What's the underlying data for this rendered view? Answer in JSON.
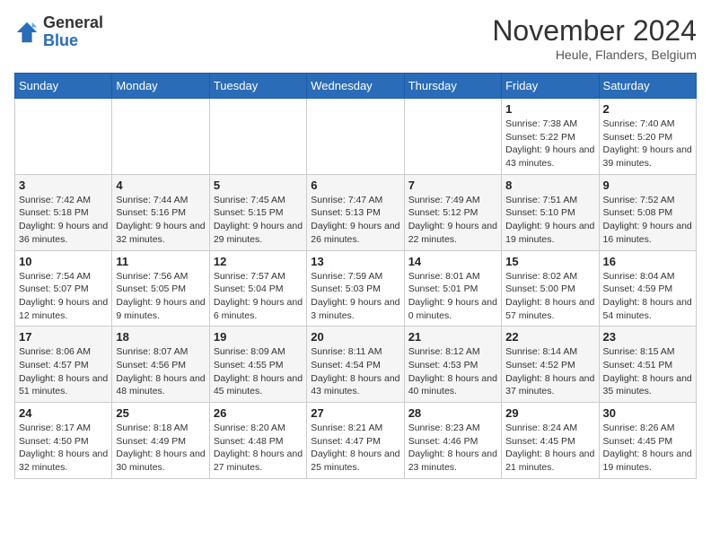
{
  "header": {
    "logo_general": "General",
    "logo_blue": "Blue",
    "month_title": "November 2024",
    "location": "Heule, Flanders, Belgium"
  },
  "weekdays": [
    "Sunday",
    "Monday",
    "Tuesday",
    "Wednesday",
    "Thursday",
    "Friday",
    "Saturday"
  ],
  "weeks": [
    [
      {
        "day": "",
        "sunrise": "",
        "sunset": "",
        "daylight": ""
      },
      {
        "day": "",
        "sunrise": "",
        "sunset": "",
        "daylight": ""
      },
      {
        "day": "",
        "sunrise": "",
        "sunset": "",
        "daylight": ""
      },
      {
        "day": "",
        "sunrise": "",
        "sunset": "",
        "daylight": ""
      },
      {
        "day": "",
        "sunrise": "",
        "sunset": "",
        "daylight": ""
      },
      {
        "day": "1",
        "sunrise": "Sunrise: 7:38 AM",
        "sunset": "Sunset: 5:22 PM",
        "daylight": "Daylight: 9 hours and 43 minutes."
      },
      {
        "day": "2",
        "sunrise": "Sunrise: 7:40 AM",
        "sunset": "Sunset: 5:20 PM",
        "daylight": "Daylight: 9 hours and 39 minutes."
      }
    ],
    [
      {
        "day": "3",
        "sunrise": "Sunrise: 7:42 AM",
        "sunset": "Sunset: 5:18 PM",
        "daylight": "Daylight: 9 hours and 36 minutes."
      },
      {
        "day": "4",
        "sunrise": "Sunrise: 7:44 AM",
        "sunset": "Sunset: 5:16 PM",
        "daylight": "Daylight: 9 hours and 32 minutes."
      },
      {
        "day": "5",
        "sunrise": "Sunrise: 7:45 AM",
        "sunset": "Sunset: 5:15 PM",
        "daylight": "Daylight: 9 hours and 29 minutes."
      },
      {
        "day": "6",
        "sunrise": "Sunrise: 7:47 AM",
        "sunset": "Sunset: 5:13 PM",
        "daylight": "Daylight: 9 hours and 26 minutes."
      },
      {
        "day": "7",
        "sunrise": "Sunrise: 7:49 AM",
        "sunset": "Sunset: 5:12 PM",
        "daylight": "Daylight: 9 hours and 22 minutes."
      },
      {
        "day": "8",
        "sunrise": "Sunrise: 7:51 AM",
        "sunset": "Sunset: 5:10 PM",
        "daylight": "Daylight: 9 hours and 19 minutes."
      },
      {
        "day": "9",
        "sunrise": "Sunrise: 7:52 AM",
        "sunset": "Sunset: 5:08 PM",
        "daylight": "Daylight: 9 hours and 16 minutes."
      }
    ],
    [
      {
        "day": "10",
        "sunrise": "Sunrise: 7:54 AM",
        "sunset": "Sunset: 5:07 PM",
        "daylight": "Daylight: 9 hours and 12 minutes."
      },
      {
        "day": "11",
        "sunrise": "Sunrise: 7:56 AM",
        "sunset": "Sunset: 5:05 PM",
        "daylight": "Daylight: 9 hours and 9 minutes."
      },
      {
        "day": "12",
        "sunrise": "Sunrise: 7:57 AM",
        "sunset": "Sunset: 5:04 PM",
        "daylight": "Daylight: 9 hours and 6 minutes."
      },
      {
        "day": "13",
        "sunrise": "Sunrise: 7:59 AM",
        "sunset": "Sunset: 5:03 PM",
        "daylight": "Daylight: 9 hours and 3 minutes."
      },
      {
        "day": "14",
        "sunrise": "Sunrise: 8:01 AM",
        "sunset": "Sunset: 5:01 PM",
        "daylight": "Daylight: 9 hours and 0 minutes."
      },
      {
        "day": "15",
        "sunrise": "Sunrise: 8:02 AM",
        "sunset": "Sunset: 5:00 PM",
        "daylight": "Daylight: 8 hours and 57 minutes."
      },
      {
        "day": "16",
        "sunrise": "Sunrise: 8:04 AM",
        "sunset": "Sunset: 4:59 PM",
        "daylight": "Daylight: 8 hours and 54 minutes."
      }
    ],
    [
      {
        "day": "17",
        "sunrise": "Sunrise: 8:06 AM",
        "sunset": "Sunset: 4:57 PM",
        "daylight": "Daylight: 8 hours and 51 minutes."
      },
      {
        "day": "18",
        "sunrise": "Sunrise: 8:07 AM",
        "sunset": "Sunset: 4:56 PM",
        "daylight": "Daylight: 8 hours and 48 minutes."
      },
      {
        "day": "19",
        "sunrise": "Sunrise: 8:09 AM",
        "sunset": "Sunset: 4:55 PM",
        "daylight": "Daylight: 8 hours and 45 minutes."
      },
      {
        "day": "20",
        "sunrise": "Sunrise: 8:11 AM",
        "sunset": "Sunset: 4:54 PM",
        "daylight": "Daylight: 8 hours and 43 minutes."
      },
      {
        "day": "21",
        "sunrise": "Sunrise: 8:12 AM",
        "sunset": "Sunset: 4:53 PM",
        "daylight": "Daylight: 8 hours and 40 minutes."
      },
      {
        "day": "22",
        "sunrise": "Sunrise: 8:14 AM",
        "sunset": "Sunset: 4:52 PM",
        "daylight": "Daylight: 8 hours and 37 minutes."
      },
      {
        "day": "23",
        "sunrise": "Sunrise: 8:15 AM",
        "sunset": "Sunset: 4:51 PM",
        "daylight": "Daylight: 8 hours and 35 minutes."
      }
    ],
    [
      {
        "day": "24",
        "sunrise": "Sunrise: 8:17 AM",
        "sunset": "Sunset: 4:50 PM",
        "daylight": "Daylight: 8 hours and 32 minutes."
      },
      {
        "day": "25",
        "sunrise": "Sunrise: 8:18 AM",
        "sunset": "Sunset: 4:49 PM",
        "daylight": "Daylight: 8 hours and 30 minutes."
      },
      {
        "day": "26",
        "sunrise": "Sunrise: 8:20 AM",
        "sunset": "Sunset: 4:48 PM",
        "daylight": "Daylight: 8 hours and 27 minutes."
      },
      {
        "day": "27",
        "sunrise": "Sunrise: 8:21 AM",
        "sunset": "Sunset: 4:47 PM",
        "daylight": "Daylight: 8 hours and 25 minutes."
      },
      {
        "day": "28",
        "sunrise": "Sunrise: 8:23 AM",
        "sunset": "Sunset: 4:46 PM",
        "daylight": "Daylight: 8 hours and 23 minutes."
      },
      {
        "day": "29",
        "sunrise": "Sunrise: 8:24 AM",
        "sunset": "Sunset: 4:45 PM",
        "daylight": "Daylight: 8 hours and 21 minutes."
      },
      {
        "day": "30",
        "sunrise": "Sunrise: 8:26 AM",
        "sunset": "Sunset: 4:45 PM",
        "daylight": "Daylight: 8 hours and 19 minutes."
      }
    ]
  ]
}
